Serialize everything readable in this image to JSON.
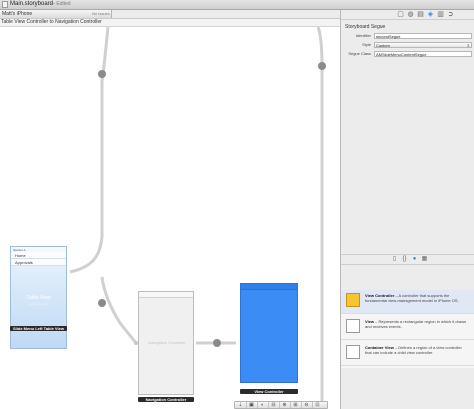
{
  "window": {
    "title": "Main.storyboard",
    "status": "— Edited"
  },
  "device_bar": {
    "device": "Matt's iPhone",
    "issues": "No Issues"
  },
  "breadcrumb": "Table View Controller to Navigation Controller",
  "inspector": {
    "section_title": "Storyboard Segue",
    "identifier_label": "Identifier",
    "identifier_value": "secondSegue",
    "style_label": "Style",
    "style_value": "Custom",
    "segue_class_label": "Segue Class",
    "segue_class_value": "AMSlideMenuContentSegue",
    "tab_icons": [
      "file-icon",
      "help-icon",
      "identity-icon",
      "attributes-icon",
      "size-icon",
      "connections-icon"
    ],
    "library_tab_icons": [
      "file-template-icon",
      "code-snippet-icon",
      "object-library-icon",
      "media-library-icon"
    ]
  },
  "library": {
    "items": [
      {
        "title": "View Controller",
        "desc": " – A controller that supports the fundamental view-management model in iPhone OS."
      },
      {
        "title": "View",
        "desc": " – Represents a rectangular region in which it draws and receives events."
      },
      {
        "title": "Container View",
        "desc": " – Defines a region of a view controller that can include a child view controller."
      }
    ]
  },
  "canvas": {
    "table_scene": {
      "section": "Section-1",
      "cells": [
        "Home",
        "Approvals"
      ],
      "center_title": "Table View",
      "center_sub": "Static Content",
      "label": "Slide Menu Left Table View"
    },
    "nav_scene": {
      "caption": "Navigation Controller",
      "label": "Navigation Controller"
    },
    "vc_scene": {
      "label": "View Controller"
    }
  },
  "zoombar": {
    "buttons": [
      "⇣",
      "▣",
      "◐",
      "⊟",
      "⊕",
      "⊞",
      "⊖",
      "⊡"
    ]
  },
  "colors": {
    "accent": "#3a83d9",
    "vc_blue": "#3b8cf4",
    "segue_line": "#d0d0d0"
  }
}
